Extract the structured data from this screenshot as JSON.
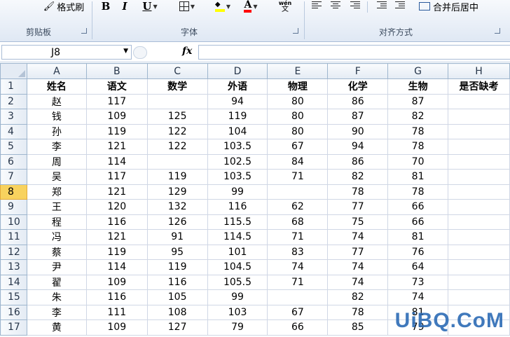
{
  "ribbon": {
    "clipboard_label": "剪贴板",
    "format_painter_label": "格式刷",
    "font_label": "字体",
    "alignment_label": "对齐方式",
    "bold_label": "B",
    "italic_label": "I",
    "underline_label": "U",
    "phonetic_top": "wén",
    "phonetic_bottom": "文",
    "merge_center_label": "合并后居中",
    "fill_color": "#ffff00",
    "font_color": "#ff0000"
  },
  "formula_bar": {
    "name_box": "J8",
    "fx_label": "fx",
    "formula": ""
  },
  "grid": {
    "columns": [
      "A",
      "B",
      "C",
      "D",
      "E",
      "F",
      "G",
      "H"
    ],
    "active_row": "8",
    "rows": [
      {
        "num": "1",
        "cells": [
          "姓名",
          "语文",
          "数学",
          "外语",
          "物理",
          "化学",
          "生物",
          "是否缺考"
        ]
      },
      {
        "num": "2",
        "cells": [
          "赵",
          "117",
          "",
          "94",
          "80",
          "86",
          "87",
          ""
        ]
      },
      {
        "num": "3",
        "cells": [
          "钱",
          "109",
          "125",
          "119",
          "80",
          "87",
          "82",
          ""
        ]
      },
      {
        "num": "4",
        "cells": [
          "孙",
          "119",
          "122",
          "104",
          "80",
          "90",
          "78",
          ""
        ]
      },
      {
        "num": "5",
        "cells": [
          "李",
          "121",
          "122",
          "103.5",
          "67",
          "94",
          "78",
          ""
        ]
      },
      {
        "num": "6",
        "cells": [
          "周",
          "114",
          "",
          "102.5",
          "84",
          "86",
          "70",
          ""
        ]
      },
      {
        "num": "7",
        "cells": [
          "吴",
          "117",
          "119",
          "103.5",
          "71",
          "82",
          "81",
          ""
        ]
      },
      {
        "num": "8",
        "cells": [
          "郑",
          "121",
          "129",
          "99",
          "",
          "78",
          "78",
          ""
        ]
      },
      {
        "num": "9",
        "cells": [
          "王",
          "120",
          "132",
          "116",
          "62",
          "77",
          "66",
          ""
        ]
      },
      {
        "num": "10",
        "cells": [
          "程",
          "116",
          "126",
          "115.5",
          "68",
          "75",
          "66",
          ""
        ]
      },
      {
        "num": "11",
        "cells": [
          "冯",
          "121",
          "91",
          "114.5",
          "71",
          "74",
          "81",
          ""
        ]
      },
      {
        "num": "12",
        "cells": [
          "蔡",
          "119",
          "95",
          "101",
          "83",
          "77",
          "76",
          ""
        ]
      },
      {
        "num": "13",
        "cells": [
          "尹",
          "114",
          "119",
          "104.5",
          "74",
          "74",
          "64",
          ""
        ]
      },
      {
        "num": "14",
        "cells": [
          "翟",
          "109",
          "116",
          "105.5",
          "71",
          "74",
          "73",
          ""
        ]
      },
      {
        "num": "15",
        "cells": [
          "朱",
          "116",
          "105",
          "99",
          "",
          "82",
          "74",
          ""
        ]
      },
      {
        "num": "16",
        "cells": [
          "李",
          "111",
          "108",
          "103",
          "67",
          "78",
          "81",
          ""
        ]
      },
      {
        "num": "17",
        "cells": [
          "黄",
          "109",
          "127",
          "79",
          "66",
          "85",
          "79",
          ""
        ]
      }
    ]
  },
  "watermark": "UiBQ.CoM"
}
